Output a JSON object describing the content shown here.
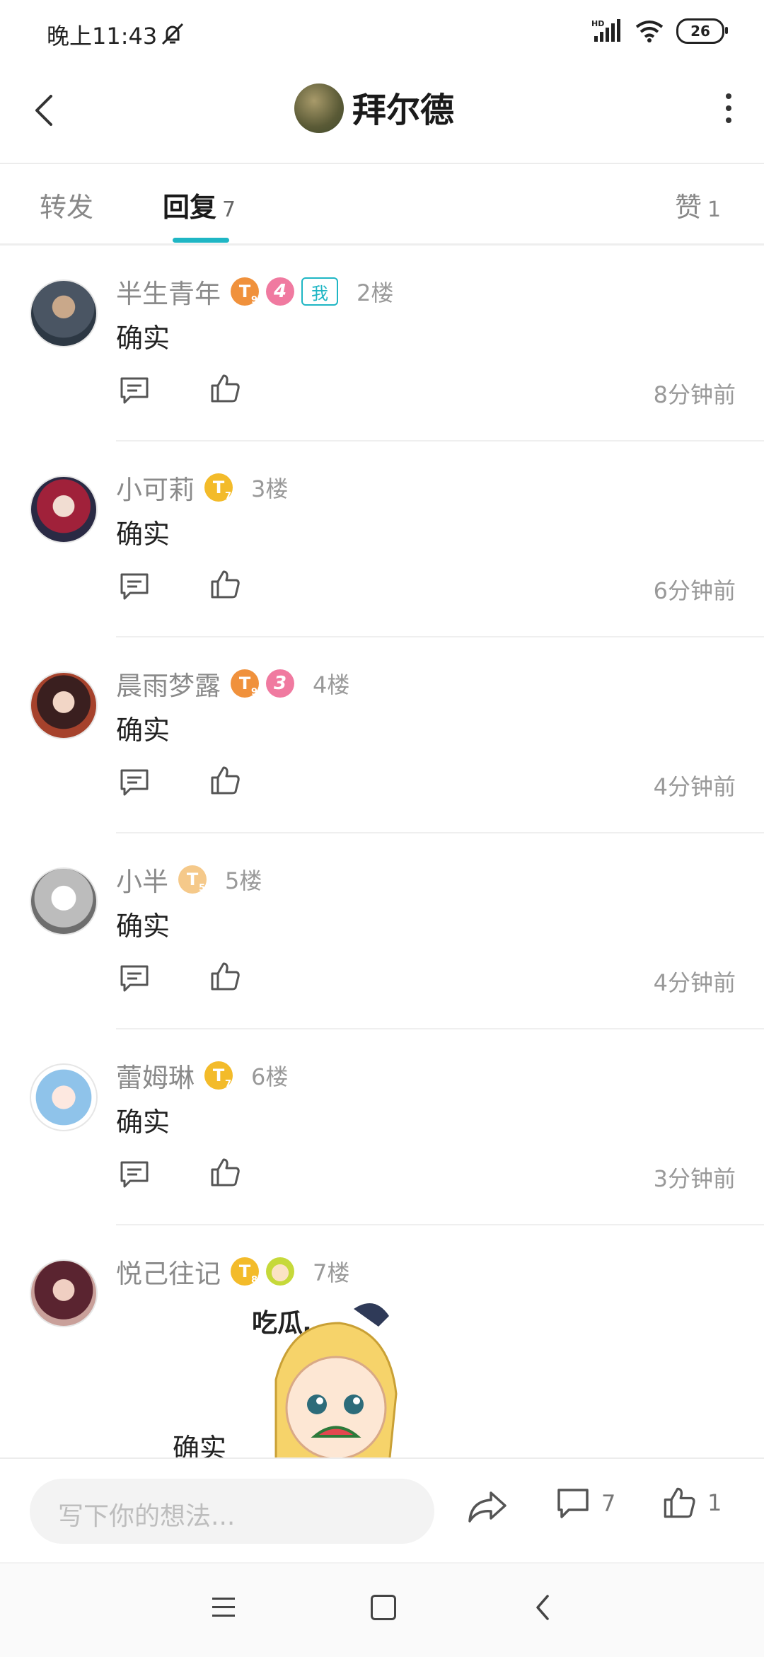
{
  "status_bar": {
    "time": "晚上11:43",
    "network": "HD",
    "battery": "26"
  },
  "header": {
    "title": "拜尔德"
  },
  "tabs": [
    {
      "label": "转发",
      "count": ""
    },
    {
      "label": "回复",
      "count": "7"
    },
    {
      "label": "赞",
      "count": "1"
    }
  ],
  "replies": [
    {
      "username": "半生青年",
      "level": "9",
      "badge_num": "4",
      "me_tag": "我",
      "floor": "2楼",
      "content": "确实",
      "time": "8分钟前"
    },
    {
      "username": "小可莉",
      "level": "7",
      "floor": "3楼",
      "content": "确实",
      "time": "6分钟前"
    },
    {
      "username": "晨雨梦露",
      "level": "9",
      "badge_num": "3",
      "floor": "4楼",
      "content": "确实",
      "time": "4分钟前"
    },
    {
      "username": "小半",
      "level": "5",
      "floor": "5楼",
      "content": "确实",
      "time": "4分钟前"
    },
    {
      "username": "蕾姆琳",
      "level": "7",
      "floor": "6楼",
      "content": "确实",
      "time": "3分钟前"
    },
    {
      "username": "悦己往记",
      "level": "8",
      "floor": "7楼",
      "content": "确实",
      "sticker_text": "吃瓜…"
    }
  ],
  "badge_letter": "T",
  "input_bar": {
    "placeholder": "写下你的想法...",
    "comment_count": "7",
    "like_count": "1"
  },
  "colors": {
    "accent": "#1fb6c4",
    "badge_orange": "#f0913c",
    "badge_gold": "#f3bb2a",
    "badge_pink": "#f07aa0"
  }
}
